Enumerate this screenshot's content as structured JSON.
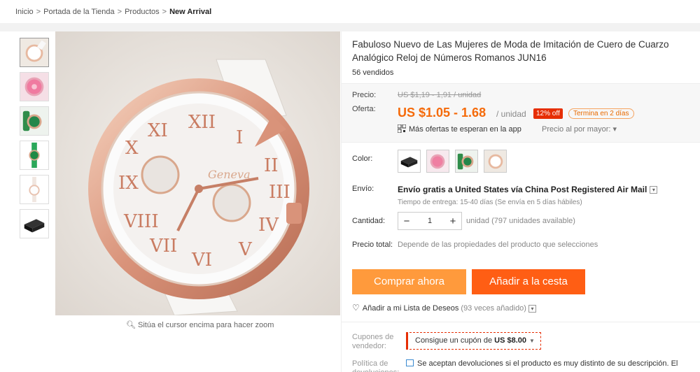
{
  "breadcrumb": {
    "items": [
      "Inicio",
      "Portada de la Tienda",
      "Productos"
    ],
    "current": "New Arrival",
    "separator": ">"
  },
  "gallery": {
    "zoom_hint": "Sitúa el cursor encima para hacer zoom",
    "thumbnails": [
      "white-watch",
      "pink-watch",
      "green-watch",
      "green-watch-strap",
      "white-watch-small",
      "black-gift-box"
    ]
  },
  "product": {
    "title": "Fabuloso Nuevo de Las Mujeres de Moda de Imitación de Cuero de Cuarzo Analógico Reloj de Números Romanos JUN16",
    "sold": "56 vendidos"
  },
  "pricing": {
    "price_label": "Precio:",
    "original_price": "US $1,19 - 1,91 / unidad",
    "offer_label": "Oferta:",
    "offer_price": "US $1.05 - 1.68",
    "unit": "/ unidad",
    "discount": "12% off",
    "ends": "Termina en 2 días",
    "app_offers": "Más ofertas te esperan en la app",
    "wholesale": "Precio al por mayor:"
  },
  "options": {
    "color_label": "Color:",
    "shipping_label": "Envío:",
    "shipping_main": "Envío gratis a United States vía China Post Registered Air Mail",
    "shipping_sub": "Tiempo de entrega: 15-40 días (Se envía en 5 días hábiles)",
    "quantity_label": "Cantidad:",
    "quantity_value": "1",
    "quantity_minus": "−",
    "quantity_plus": "+",
    "quantity_unit": "unidad (797 unidades available)",
    "total_label": "Precio total:",
    "total_text": "Depende de las propiedades del producto que selecciones"
  },
  "actions": {
    "buy_now": "Comprar ahora",
    "add_to_cart": "Añadir a la cesta",
    "wishlist": "Añadir a mi Lista de Deseos",
    "wishlist_count": "(93 veces añadido)"
  },
  "coupon": {
    "label": "Cupones de vendedor:",
    "text": "Consigue un cupón de",
    "amount": "US $8.00"
  },
  "returns": {
    "label": "Política de devoluciones:",
    "text": "Se aceptan devoluciones si el producto es muy distinto de su descripción. El"
  },
  "colors": {
    "accent_orange": "#ff9a3c",
    "cart_orange": "#ff5e14",
    "price_orange": "#f56a0a",
    "discount_red": "#e62e04"
  }
}
